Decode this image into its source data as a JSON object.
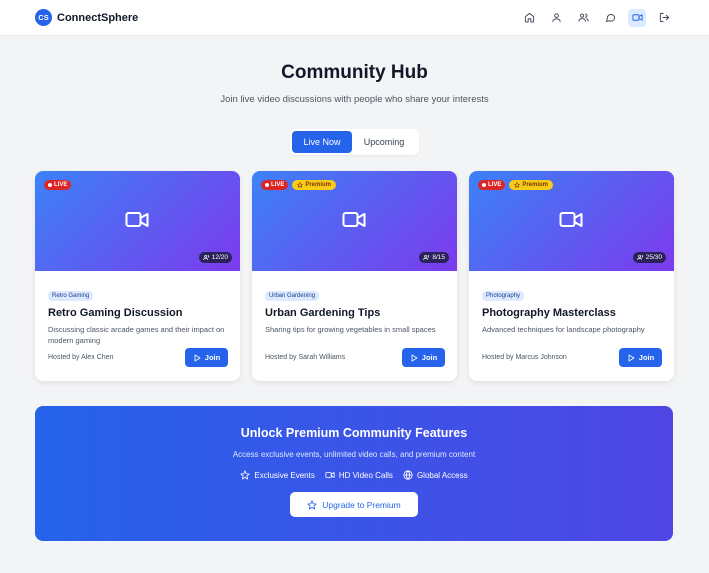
{
  "nav": {
    "logo_text": "CS",
    "brand": "ConnectSphere",
    "icons": [
      "home-icon",
      "user-icon",
      "users-icon",
      "chat-icon",
      "video-icon",
      "logout-icon"
    ]
  },
  "hero": {
    "title": "Community Hub",
    "subtitle": "Join live video discussions with people who share your interests"
  },
  "tabs": [
    {
      "label": "Live Now",
      "active": true
    },
    {
      "label": "Upcoming",
      "active": false
    }
  ],
  "cards": [
    {
      "live": "LIVE",
      "premium": "",
      "count": "12/20",
      "category": "Retro Gaming",
      "title": "Retro Gaming Discussion",
      "description": "Discussing classic arcade games and their impact on modern gaming",
      "host": "Hosted by Alex Chen",
      "join_label": "Join"
    },
    {
      "live": "LIVE",
      "premium": "Premium",
      "count": "8/15",
      "category": "Urban Gardening",
      "title": "Urban Gardening Tips",
      "description": "Sharing tips for growing vegetables in small spaces",
      "host": "Hosted by Sarah Williams",
      "join_label": "Join"
    },
    {
      "live": "LIVE",
      "premium": "Premium",
      "count": "25/30",
      "category": "Photography",
      "title": "Photography Masterclass",
      "description": "Advanced techniques for landscape photography",
      "host": "Hosted by Marcus Johnson",
      "join_label": "Join"
    }
  ],
  "banner": {
    "title": "Unlock Premium Community Features",
    "subtitle": "Access exclusive events, unlimited video calls, and premium content",
    "features": [
      "Exclusive Events",
      "HD Video Calls",
      "Global Access"
    ],
    "cta": "Upgrade to Premium"
  },
  "colors": {
    "primary": "#2563eb",
    "live": "#dc2626",
    "premium": "#facc15"
  }
}
